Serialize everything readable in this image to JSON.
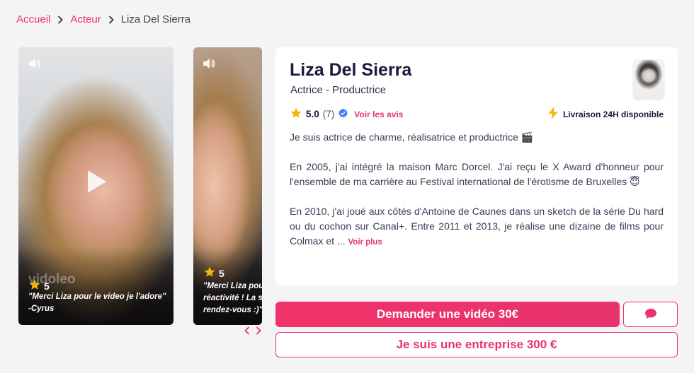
{
  "breadcrumb": {
    "items": [
      "Accueil",
      "Acteur"
    ],
    "current": "Liza Del Sierra"
  },
  "videos": [
    {
      "rating": "5",
      "quote": "\"Merci Liza pour le video je l'adore\" -Cyrus",
      "watermark": "vidoleo"
    },
    {
      "rating": "5",
      "quote_line1": "\"Merci Liza pou",
      "quote_line2": "réactivité ! La s",
      "quote_line3": "rendez-vous :)\""
    }
  ],
  "carousel": {
    "prev": "‹",
    "next": "›"
  },
  "profile": {
    "name": "Liza Del Sierra",
    "subtitle": "Actrice - Productrice",
    "rating": "5.0",
    "rating_count": "(7)",
    "see_reviews": "Voir les avis",
    "delivery": "Livraison 24H disponible",
    "bio": [
      "Je suis actrice de charme, réalisatrice et productrice 🎬",
      "En 2005, j'ai intégré la maison Marc Dorcel. J'ai reçu le X Award d'honneur pour l'ensemble de ma carrière au Festival international de l'érotisme de Bruxelles 😇",
      "En 2010, j'ai joué aux côtés d'Antoine de Caunes dans un sketch de la série Du hard ou du cochon sur Canal+. Entre 2011 et 2013, je réalise une dizaine de films pour Colmax et ..."
    ],
    "see_more": "Voir plus"
  },
  "actions": {
    "request_video": "Demander une vidéo 30€",
    "business": "Je suis une entreprise 300 €"
  },
  "colors": {
    "accent": "#e8336d",
    "star": "#f5b50a",
    "verified": "#3b82f6",
    "bolt": "#f5b50a"
  },
  "icons": [
    "chevron-right-icon",
    "speaker-icon",
    "play-icon",
    "star-icon",
    "verified-badge-icon",
    "bolt-icon",
    "chat-icon"
  ]
}
